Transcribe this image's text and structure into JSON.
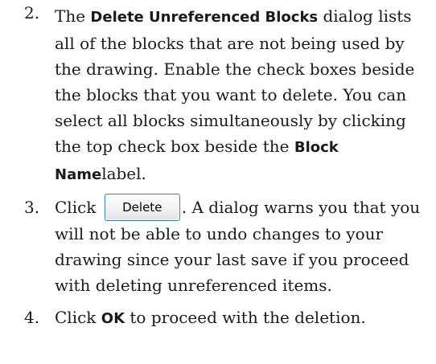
{
  "steps": [
    {
      "number": "2.",
      "t1": "The ",
      "b1": "Delete Unreferenced Blocks",
      "t2": " dialog lists all of the blocks that are not being used by the drawing. Enable the check boxes beside the blocks that you want to delete. You can select all blocks simultaneously by clicking the top check box beside the ",
      "b2": "Block Name",
      "t3": "label."
    },
    {
      "number": "3.",
      "t1": "Click ",
      "button_label": "Delete",
      "t2": ". A dialog warns you that you will not be able to undo changes to your drawing since your last save if you proceed with deleting unreferenced items."
    },
    {
      "number": "4.",
      "t1": "Click ",
      "b1": "OK",
      "t2": " to proceed with the deletion."
    }
  ]
}
